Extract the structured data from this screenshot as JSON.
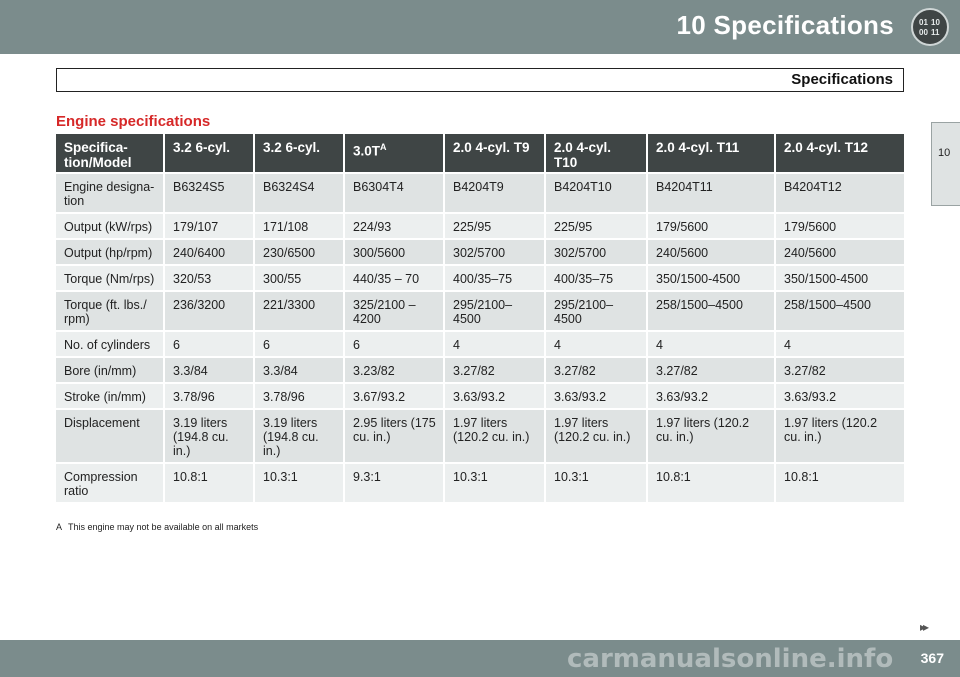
{
  "header": {
    "chapter_title": "10  Specifications",
    "chapter_icon_digits": [
      "01",
      "10",
      "00",
      "11"
    ]
  },
  "section_title": "Specifications",
  "side_tab": "10",
  "table_title": "Engine specifications",
  "table": {
    "columns": [
      "Specifica-\ntion/Model",
      "3.2 6-cyl.",
      "3.2 6-cyl.",
      "3.0T",
      "2.0 4-cyl. T9",
      "2.0 4-cyl.\nT10",
      "2.0 4-cyl. T11",
      "2.0 4-cyl. T12"
    ],
    "footnote_marker": "A",
    "rows": [
      [
        "Engine designa-\ntion",
        "B6324S5",
        "B6324S4",
        "B6304T4",
        "B4204T9",
        "B4204T10",
        "B4204T11",
        "B4204T12"
      ],
      [
        "Output (kW/rps)",
        "179/107",
        "171/108",
        "224/93",
        "225/95",
        "225/95",
        "179/5600",
        "179/5600"
      ],
      [
        "Output (hp/rpm)",
        "240/6400",
        "230/6500",
        "300/5600",
        "302/5700",
        "302/5700",
        "240/5600",
        "240/5600"
      ],
      [
        "Torque (Nm/rps)",
        "320/53",
        "300/55",
        "440/35 – 70",
        "400/35–75",
        "400/35–75",
        "350/1500-4500",
        "350/1500-4500"
      ],
      [
        "Torque (ft. lbs./\nrpm)",
        "236/3200",
        "221/3300",
        "325/2100 –\n  4200",
        "295/2100–\n4500",
        "295/2100–\n4500",
        "258/1500–4500",
        "258/1500–4500"
      ],
      [
        "No. of cylinders",
        "6",
        "6",
        "6",
        "4",
        "4",
        "4",
        "4"
      ],
      [
        "Bore (in/mm)",
        "3.3/84",
        "3.3/84",
        "3.23/82",
        "3.27/82",
        "3.27/82",
        "3.27/82",
        "3.27/82"
      ],
      [
        "Stroke (in/mm)",
        "3.78/96",
        "3.78/96",
        "3.67/93.2",
        "3.63/93.2",
        "3.63/93.2",
        "3.63/93.2",
        "3.63/93.2"
      ],
      [
        "Displacement",
        "3.19 liters\n(194.8 cu.\nin.)",
        "3.19 liters\n(194.8 cu.\nin.)",
        "2.95 liters (175\ncu. in.)",
        "1.97 liters\n(120.2 cu. in.)",
        "1.97 liters\n(120.2 cu. in.)",
        "1.97 liters (120.2\ncu. in.)",
        "1.97 liters (120.2\ncu. in.)"
      ],
      [
        "Compression\nratio",
        "10.8:1",
        "10.3:1",
        "9.3:1",
        "10.3:1",
        "10.3:1",
        "10.8:1",
        "10.8:1"
      ]
    ]
  },
  "footnote": {
    "marker": "A",
    "text": "This engine may not be available on all markets"
  },
  "next_arrows": "▸▸",
  "page_number": "367",
  "watermark": "carmanualsonline.info"
}
